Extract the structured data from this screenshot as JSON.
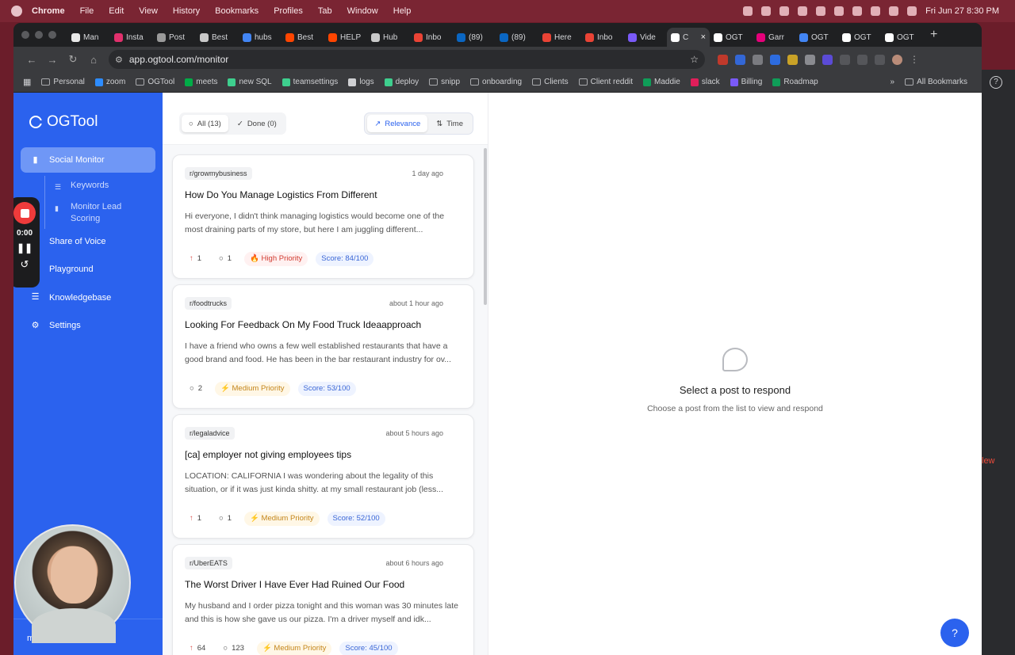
{
  "macos": {
    "app": "Chrome",
    "menus": [
      "File",
      "Edit",
      "View",
      "History",
      "Bookmarks",
      "Profiles",
      "Tab",
      "Window",
      "Help"
    ],
    "clock": "Fri Jun 27  8:30 PM"
  },
  "tabs": [
    {
      "label": "Man",
      "color": "#e9e9e9"
    },
    {
      "label": "Insta",
      "color": "#e1306c"
    },
    {
      "label": "Post",
      "color": "#9a9a9a"
    },
    {
      "label": "Best",
      "color": "#c9c9c9"
    },
    {
      "label": "hubs",
      "color": "#4285f4"
    },
    {
      "label": "Best",
      "color": "#ff4500"
    },
    {
      "label": "HELP",
      "color": "#ff4500"
    },
    {
      "label": "Hub",
      "color": "#c9c9c9"
    },
    {
      "label": "Inbo",
      "color": "#ea4335"
    },
    {
      "label": "(89)",
      "color": "#0a66c2"
    },
    {
      "label": "(89)",
      "color": "#0a66c2"
    },
    {
      "label": "Here",
      "color": "#ea4335"
    },
    {
      "label": "Inbo",
      "color": "#ea4335"
    },
    {
      "label": "Vide",
      "color": "#7a5af8"
    },
    {
      "label": "C",
      "color": "#ffffff",
      "active": true
    },
    {
      "label": "OGT",
      "color": "#ffffff"
    },
    {
      "label": "Garr",
      "color": "#e6007a"
    },
    {
      "label": "OGT",
      "color": "#4285f4"
    },
    {
      "label": "OGT",
      "color": "#ffffff"
    },
    {
      "label": "OGT",
      "color": "#ffffff"
    }
  ],
  "address": {
    "url": "app.ogtool.com/monitor"
  },
  "bookmarks": [
    {
      "label": "Personal",
      "kind": "folder"
    },
    {
      "label": "zoom",
      "kind": "site",
      "color": "#2d8cff"
    },
    {
      "label": "OGTool",
      "kind": "folder"
    },
    {
      "label": "meets",
      "kind": "site",
      "color": "#00ac47"
    },
    {
      "label": "new SQL",
      "kind": "site",
      "color": "#3ecf8e"
    },
    {
      "label": "teamsettings",
      "kind": "site",
      "color": "#3ecf8e"
    },
    {
      "label": "logs",
      "kind": "site",
      "color": "#cfd0d3"
    },
    {
      "label": "deploy",
      "kind": "site",
      "color": "#3ecf8e"
    },
    {
      "label": "snipp",
      "kind": "folder"
    },
    {
      "label": "onboarding",
      "kind": "folder"
    },
    {
      "label": "Clients",
      "kind": "folder"
    },
    {
      "label": "Client reddit",
      "kind": "folder"
    },
    {
      "label": "Maddie",
      "kind": "site",
      "color": "#0f9d58"
    },
    {
      "label": "slack",
      "kind": "site",
      "color": "#e01e5a"
    },
    {
      "label": "Billing",
      "kind": "site",
      "color": "#7a5af8"
    },
    {
      "label": "Roadmap",
      "kind": "site",
      "color": "#0f9d58"
    }
  ],
  "all_bookmarks": "All Bookmarks",
  "brand": "OGTool",
  "nav": {
    "social_monitor": "Social Monitor",
    "keywords": "Keywords",
    "lead_scoring": "Monitor Lead Scoring",
    "share_of_voice": "Share of Voice",
    "playground": "Playground",
    "knowledgebase": "Knowledgebase",
    "settings": "Settings"
  },
  "user": "ms",
  "recorder": {
    "time": "0:00"
  },
  "filters": {
    "all": "All (13)",
    "done": "Done (0)",
    "relevance": "Relevance",
    "time": "Time"
  },
  "posts": [
    {
      "sub": "r/growmybusiness",
      "time": "1 day ago",
      "title": "How Do You Manage Logistics From Different",
      "body": "Hi everyone, I didn't think managing logistics would become one of the most draining parts of my store, but here I am juggling different...",
      "up": "1",
      "comments": "1",
      "priority": "🔥 High Priority",
      "pclass": "high",
      "score": "Score: 84/100"
    },
    {
      "sub": "r/foodtrucks",
      "time": "about 1 hour ago",
      "title": "Looking For Feedback On My Food Truck Ideaapproach",
      "body": "I have a friend who owns a few well established restaurants that have a good brand and food. He has been in the bar restaurant industry for ov...",
      "up": "",
      "comments": "2",
      "priority": "⚡ Medium Priority",
      "pclass": "med",
      "score": "Score: 53/100"
    },
    {
      "sub": "r/legaladvice",
      "time": "about 5 hours ago",
      "title": "[ca] employer not giving employees tips",
      "body": "LOCATION: CALIFORNIA I was wondering about the legality of this situation, or if it was just kinda shitty. at my small restaurant job (less...",
      "up": "1",
      "comments": "1",
      "priority": "⚡ Medium Priority",
      "pclass": "med",
      "score": "Score: 52/100"
    },
    {
      "sub": "r/UberEATS",
      "time": "about 6 hours ago",
      "title": "The Worst Driver I Have Ever Had Ruined Our Food",
      "body": "My husband and I order pizza tonight and this woman was 30 minutes late and this is how she gave us our pizza. I'm a driver myself and idk...",
      "up": "64",
      "comments": "123",
      "priority": "⚡ Medium Priority",
      "pclass": "med",
      "score": "Score: 45/100"
    }
  ],
  "empty": {
    "title": "Select a post to respond",
    "subtitle": "Choose a post from the list to view and respond"
  },
  "help": "?",
  "behind_text": "lew"
}
